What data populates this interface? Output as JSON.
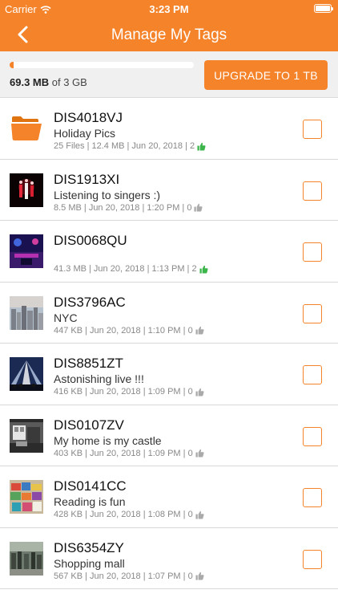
{
  "status_bar": {
    "carrier": "Carrier",
    "time": "3:23 PM"
  },
  "nav": {
    "title": "Manage My Tags"
  },
  "storage": {
    "used_value": "69.3 MB",
    "used_suffix": " of 3 GB",
    "used_fraction": 0.023,
    "upgrade_label": "UPGRADE TO 1 TB"
  },
  "colors": {
    "accent": "#f5832a",
    "like_green": "#3bb54a",
    "like_grey": "#aaaaaa"
  },
  "items": [
    {
      "name": "DIS4018VJ",
      "desc": "Holiday Pics",
      "meta": "25 Files | 12.4 MB | Jun 20, 2018 | 2",
      "likes_green": true,
      "thumb": "folder-icon"
    },
    {
      "name": "DIS1913XI",
      "desc": "Listening to singers :)",
      "meta": "8.5 MB | Jun 20, 2018 | 1:20 PM | 0",
      "likes_green": false,
      "thumb": "concert-photo"
    },
    {
      "name": "DIS0068QU",
      "desc": "",
      "meta": "41.3 MB | Jun 20, 2018 | 1:13 PM | 2",
      "likes_green": true,
      "thumb": "stage-photo"
    },
    {
      "name": "DIS3796AC",
      "desc": "NYC",
      "meta": "447 KB | Jun 20, 2018 | 1:10 PM | 0",
      "likes_green": false,
      "thumb": "city-photo"
    },
    {
      "name": "DIS8851ZT",
      "desc": "Astonishing live !!!",
      "meta": "416 KB | Jun 20, 2018 | 1:09 PM | 0",
      "likes_green": false,
      "thumb": "light-show-photo"
    },
    {
      "name": "DIS0107ZV",
      "desc": "My home is my castle",
      "meta": "403 KB | Jun 20, 2018 | 1:09 PM | 0",
      "likes_green": false,
      "thumb": "home-photo"
    },
    {
      "name": "DIS0141CC",
      "desc": "Reading is fun",
      "meta": "428 KB | Jun 20, 2018 | 1:08 PM | 0",
      "likes_green": false,
      "thumb": "books-photo"
    },
    {
      "name": "DIS6354ZY",
      "desc": "Shopping mall",
      "meta": "567 KB | Jun 20, 2018 | 1:07 PM | 0",
      "likes_green": false,
      "thumb": "mall-photo"
    }
  ]
}
